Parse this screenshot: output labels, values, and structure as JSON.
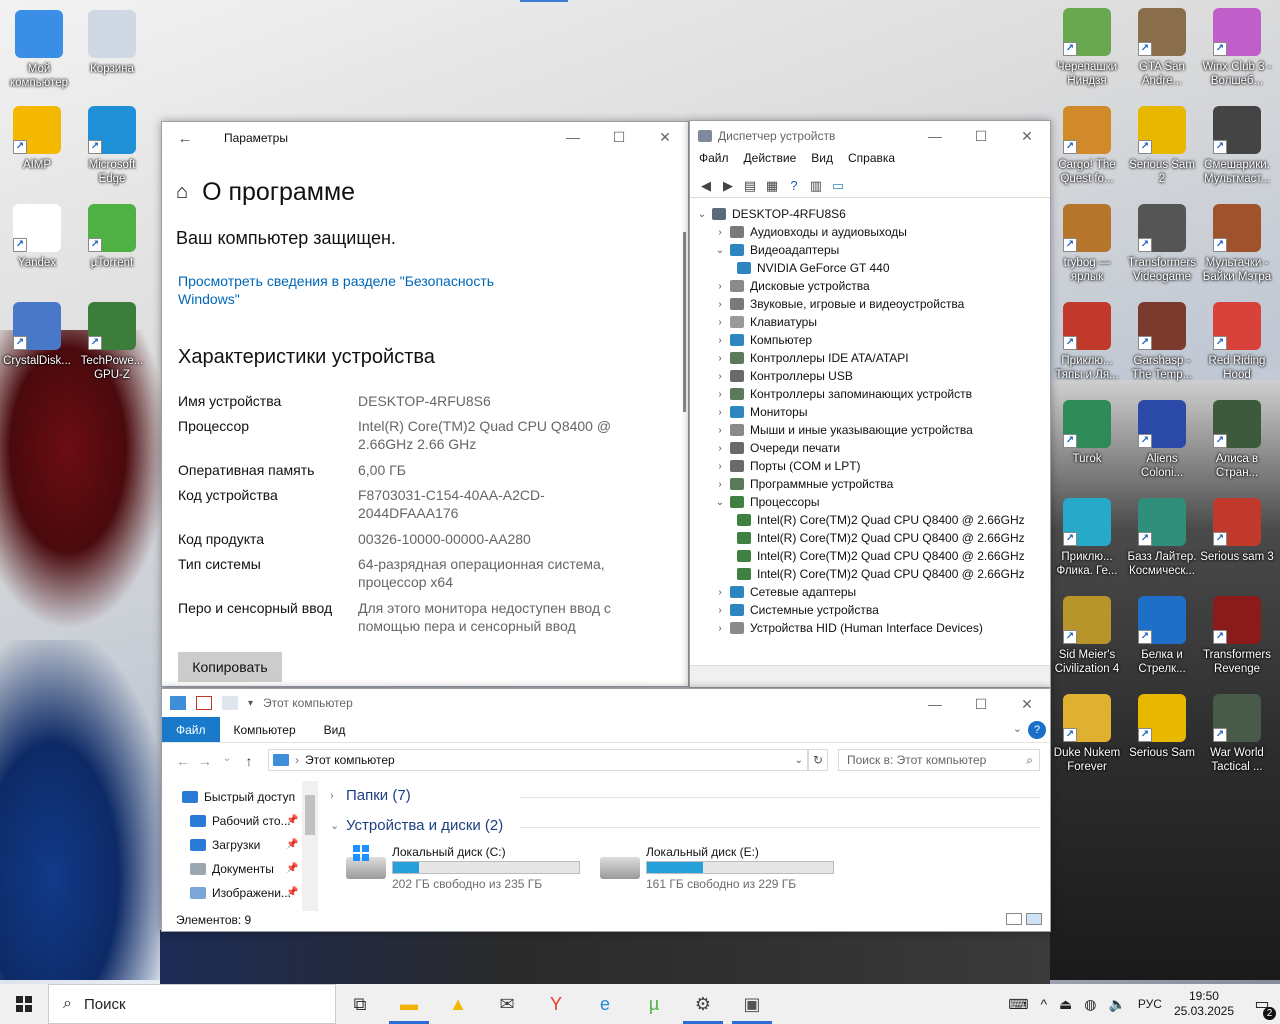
{
  "desktop": {
    "left_icons": [
      {
        "label": "Мой компьютер",
        "icon": "computer-icon",
        "color": "#3a8ee6"
      },
      {
        "label": "Корзина",
        "icon": "recycle-bin-icon",
        "color": "#cfd8e3"
      },
      {
        "label": "AIMP",
        "icon": "aimp-icon",
        "color": "#f5b800"
      },
      {
        "label": "Microsoft Edge",
        "icon": "edge-icon",
        "color": "#1f8fd6"
      },
      {
        "label": "Yandex",
        "icon": "yandex-icon",
        "color": "#ffffff"
      },
      {
        "label": "µTorrent",
        "icon": "utorrent-icon",
        "color": "#4fb044"
      },
      {
        "label": "CrystalDisk...",
        "icon": "crystaldisk-icon",
        "color": "#4a78c8"
      },
      {
        "label": "TechPowe... GPU-Z",
        "icon": "gpuz-icon",
        "color": "#3c7d3c"
      }
    ],
    "right_icons": [
      {
        "label": "Черепашки Ниндзя",
        "icon": "tmnt-icon",
        "color": "#6aa84f"
      },
      {
        "label": "GTA San Andre...",
        "icon": "gta-icon",
        "color": "#8a6d4b"
      },
      {
        "label": "Winx Club 3 - Волшеб...",
        "icon": "winx-icon",
        "color": "#c05fc9"
      },
      {
        "label": "Cargo! The Quest fo...",
        "icon": "cargo-icon",
        "color": "#d08a2a"
      },
      {
        "label": "Serious Sam 2",
        "icon": "serious-sam-2-icon",
        "color": "#e8b700"
      },
      {
        "label": "Смешарики. Мультмаст...",
        "icon": "clapperboard-icon",
        "color": "#444444"
      },
      {
        "label": "trybog — ярлык",
        "icon": "trybog-icon",
        "color": "#b5762c"
      },
      {
        "label": "Transformers Videogame",
        "icon": "transformers-icon",
        "color": "#555555"
      },
      {
        "label": "Мультачки - Байки Мэтра",
        "icon": "cars-icon",
        "color": "#a0522d"
      },
      {
        "label": "Приклю... Тяпы и Ля...",
        "icon": "adventure-icon",
        "color": "#c0392b"
      },
      {
        "label": "Garshasp - The Temp...",
        "icon": "garshasp-icon",
        "color": "#7a3b2e"
      },
      {
        "label": "Red Riding Hood",
        "icon": "red-riding-hood-icon",
        "color": "#d8423a"
      },
      {
        "label": "Turok",
        "icon": "turok-icon",
        "color": "#2e8b57"
      },
      {
        "label": "Aliens Coloni...",
        "icon": "aliens-icon",
        "color": "#2b4aa8"
      },
      {
        "label": "Алиса в Стран...",
        "icon": "alice-icon",
        "color": "#3d5a3d"
      },
      {
        "label": "Приклю... Флика. Ге...",
        "icon": "flik-icon",
        "color": "#27a9c9"
      },
      {
        "label": "Базз Лайтер. Космическ...",
        "icon": "buzz-icon",
        "color": "#2f8f7a"
      },
      {
        "label": "Serious sam 3",
        "icon": "serious-sam-3-icon",
        "color": "#c0392b"
      },
      {
        "label": "Sid Meier's Civilization 4",
        "icon": "civ4-icon",
        "color": "#b8952a"
      },
      {
        "label": "Белка и Стрелк...",
        "icon": "star-icon",
        "color": "#1f6fc9"
      },
      {
        "label": "Transformers Revenge",
        "icon": "transformers-revenge-icon",
        "color": "#8b1a1a"
      },
      {
        "label": "Duke Nukem Forever",
        "icon": "duke-nukem-icon",
        "color": "#e0b030"
      },
      {
        "label": "Serious Sam",
        "icon": "serious-sam-icon",
        "color": "#e8b700"
      },
      {
        "label": "War World Tactical ...",
        "icon": "war-world-icon",
        "color": "#4a5a4a"
      }
    ]
  },
  "settings": {
    "window_title": "Параметры",
    "page_title": "О программе",
    "protected": "Ваш компьютер защищен.",
    "security_link": "Просмотреть сведения в разделе \"Безопасность Windows\"",
    "specs_title": "Характеристики устройства",
    "specs": [
      {
        "key": "Имя устройства",
        "value": "DESKTOP-4RFU8S6"
      },
      {
        "key": "Процессор",
        "value": "Intel(R) Core(TM)2 Quad CPU    Q8400  @ 2.66GHz   2.66 GHz"
      },
      {
        "key": "Оперативная память",
        "value": "6,00 ГБ"
      },
      {
        "key": "Код устройства",
        "value": "F8703031-C154-40AA-A2CD-2044DFAAA176"
      },
      {
        "key": "Код продукта",
        "value": "00326-10000-00000-AA280"
      },
      {
        "key": "Тип системы",
        "value": "64-разрядная операционная система, процессор x64"
      },
      {
        "key": "Перо и сенсорный ввод",
        "value": "Для этого монитора недоступен ввод с помощью пера и сенсорный ввод"
      }
    ],
    "copy_button": "Копировать"
  },
  "devmgr": {
    "window_title": "Диспетчер устройств",
    "menu": [
      "Файл",
      "Действие",
      "Вид",
      "Справка"
    ],
    "root": "DESKTOP-4RFU8S6",
    "nodes": [
      {
        "label": "Аудиовходы и аудиовыходы",
        "level": 1,
        "expander": "›",
        "color": "#7a7a7a"
      },
      {
        "label": "Видеоадаптеры",
        "level": 1,
        "expander": "⌄",
        "color": "#2e86c1"
      },
      {
        "label": "NVIDIA GeForce GT 440",
        "level": 2,
        "expander": "",
        "color": "#2e86c1"
      },
      {
        "label": "Дисковые устройства",
        "level": 1,
        "expander": "›",
        "color": "#8a8a8a"
      },
      {
        "label": "Звуковые, игровые и видеоустройства",
        "level": 1,
        "expander": "›",
        "color": "#7a7a7a"
      },
      {
        "label": "Клавиатуры",
        "level": 1,
        "expander": "›",
        "color": "#9a9a9a"
      },
      {
        "label": "Компьютер",
        "level": 1,
        "expander": "›",
        "color": "#2e86c1"
      },
      {
        "label": "Контроллеры IDE ATA/ATAPI",
        "level": 1,
        "expander": "›",
        "color": "#5a7a5a"
      },
      {
        "label": "Контроллеры USB",
        "level": 1,
        "expander": "›",
        "color": "#6a6a6a"
      },
      {
        "label": "Контроллеры запоминающих устройств",
        "level": 1,
        "expander": "›",
        "color": "#5a7a5a"
      },
      {
        "label": "Мониторы",
        "level": 1,
        "expander": "›",
        "color": "#2e86c1"
      },
      {
        "label": "Мыши и иные указывающие устройства",
        "level": 1,
        "expander": "›",
        "color": "#8a8a8a"
      },
      {
        "label": "Очереди печати",
        "level": 1,
        "expander": "›",
        "color": "#6a6a6a"
      },
      {
        "label": "Порты (COM и LPT)",
        "level": 1,
        "expander": "›",
        "color": "#6a6a6a"
      },
      {
        "label": "Программные устройства",
        "level": 1,
        "expander": "›",
        "color": "#5a7a5a"
      },
      {
        "label": "Процессоры",
        "level": 1,
        "expander": "⌄",
        "color": "#3f7f3f"
      },
      {
        "label": "Intel(R) Core(TM)2 Quad CPU    Q8400  @ 2.66GHz",
        "level": 2,
        "expander": "",
        "color": "#3f7f3f"
      },
      {
        "label": "Intel(R) Core(TM)2 Quad CPU    Q8400  @ 2.66GHz",
        "level": 2,
        "expander": "",
        "color": "#3f7f3f"
      },
      {
        "label": "Intel(R) Core(TM)2 Quad CPU    Q8400  @ 2.66GHz",
        "level": 2,
        "expander": "",
        "color": "#3f7f3f"
      },
      {
        "label": "Intel(R) Core(TM)2 Quad CPU    Q8400  @ 2.66GHz",
        "level": 2,
        "expander": "",
        "color": "#3f7f3f"
      },
      {
        "label": "Сетевые адаптеры",
        "level": 1,
        "expander": "›",
        "color": "#2e86c1"
      },
      {
        "label": "Системные устройства",
        "level": 1,
        "expander": "›",
        "color": "#2e86c1"
      },
      {
        "label": "Устройства HID (Human Interface Devices)",
        "level": 1,
        "expander": "›",
        "color": "#8a8a8a"
      }
    ]
  },
  "explorer": {
    "window_title": "Этот компьютер",
    "tabs": [
      "Файл",
      "Компьютер",
      "Вид"
    ],
    "address": "Этот компьютер",
    "search_placeholder": "Поиск в: Этот компьютер",
    "nav_items": [
      {
        "label": "Быстрый доступ",
        "color": "#2b7bd6",
        "pinned": false
      },
      {
        "label": "Рабочий сто...",
        "color": "#2b7bd6",
        "pinned": true
      },
      {
        "label": "Загрузки",
        "color": "#2b7bd6",
        "pinned": true
      },
      {
        "label": "Документы",
        "color": "#9aa6b2",
        "pinned": true
      },
      {
        "label": "Изображени...",
        "color": "#7aa7d6",
        "pinned": true
      }
    ],
    "groups": [
      {
        "label": "Папки (7)",
        "expander": "›"
      },
      {
        "label": "Устройства и диски (2)",
        "expander": "⌄"
      }
    ],
    "drives": [
      {
        "name": "Локальный диск (C:)",
        "free": "202 ГБ свободно из 235 ГБ",
        "used_fraction": 0.14,
        "windows_logo": true
      },
      {
        "name": "Локальный диск (E:)",
        "free": "161 ГБ свободно из 229 ГБ",
        "used_fraction": 0.3,
        "windows_logo": false
      }
    ],
    "status": "Элементов: 9"
  },
  "taskbar": {
    "search_text": "Поиск",
    "apps": [
      {
        "name": "task-view",
        "glyph": "⧉",
        "running": false,
        "color": "#333333"
      },
      {
        "name": "file-explorer",
        "glyph": "▬",
        "running": true,
        "color": "#f0b400"
      },
      {
        "name": "aimp",
        "glyph": "▲",
        "running": false,
        "color": "#f5b800"
      },
      {
        "name": "mail",
        "glyph": "✉",
        "running": false,
        "color": "#444444"
      },
      {
        "name": "yandex",
        "glyph": "Y",
        "running": false,
        "color": "#e63b2e"
      },
      {
        "name": "edge",
        "glyph": "e",
        "running": false,
        "color": "#1f8fd6"
      },
      {
        "name": "utorrent",
        "glyph": "µ",
        "running": false,
        "color": "#4fb044"
      },
      {
        "name": "settings",
        "glyph": "⚙",
        "running": true,
        "color": "#444444"
      },
      {
        "name": "device-manager",
        "glyph": "▣",
        "running": true,
        "color": "#555555"
      }
    ],
    "lang": "РУС",
    "time": "19:50",
    "date": "25.03.2025",
    "notifications": "2"
  }
}
